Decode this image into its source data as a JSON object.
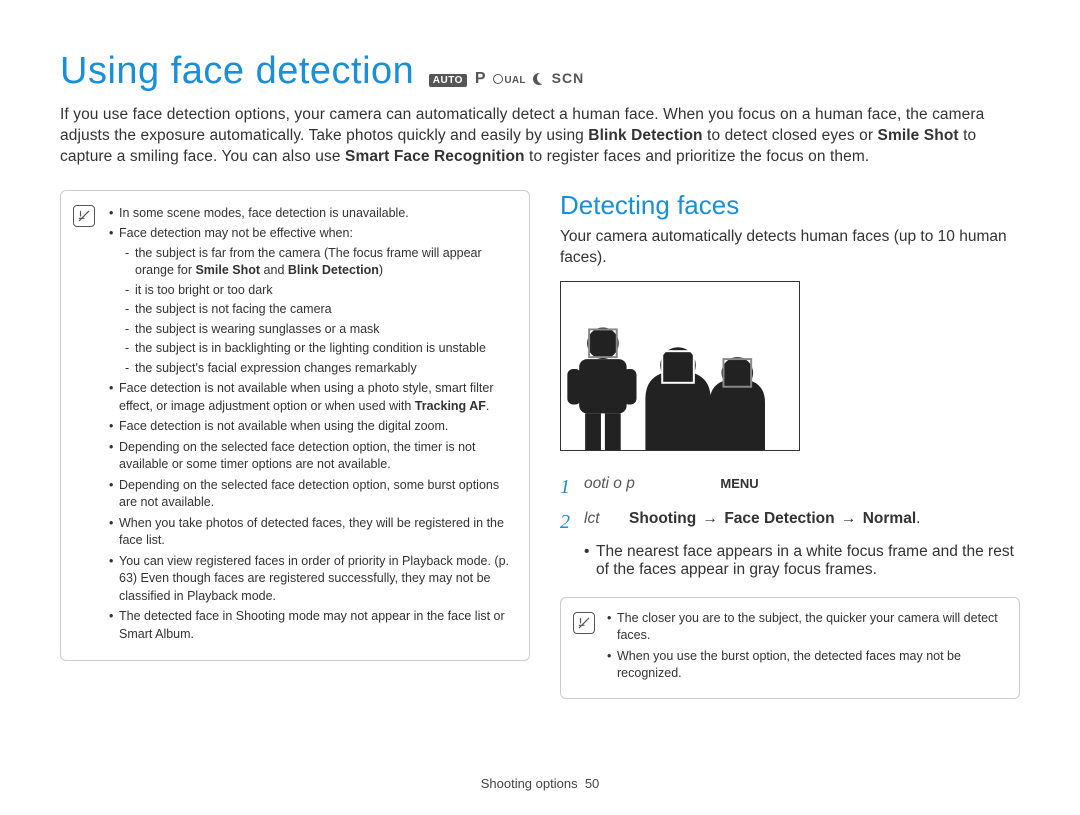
{
  "page_title": "Using face detection",
  "mode_icons": {
    "auto": "AUTO",
    "p": "P",
    "dual": "UAL",
    "scn": "SCN"
  },
  "intro_parts": {
    "a": "If you use face detection options, your camera can automatically detect a human face. When you focus on a human face, the camera adjusts the exposure automatically. Take photos quickly and easily by using ",
    "b1": "Blink Detection",
    "c": " to detect closed eyes or ",
    "b2": "Smile Shot",
    "d": " to capture a smiling face. You can also use ",
    "b3": "Smart Face Recognition",
    "e": " to register faces and prioritize the focus on them."
  },
  "left_notes": {
    "n1": "In some scene modes, face detection is unavailable.",
    "n2": "Face detection may not be effective when:",
    "n2_sub": {
      "s1a": "the subject is far from the camera (The focus frame will appear orange for ",
      "s1b1": "Smile Shot",
      "s1mid": " and ",
      "s1b2": "Blink Detection",
      "s1c": ")",
      "s2": "it is too bright or too dark",
      "s3": "the subject is not facing the camera",
      "s4": "the subject is wearing sunglasses or a mask",
      "s5": "the subject is in backlighting or the lighting condition is unstable",
      "s6": "the subject's facial expression changes remarkably"
    },
    "n3a": "Face detection is not available when using a photo style, smart filter effect, or image adjustment option or when used with ",
    "n3b": "Tracking AF",
    "n3c": ".",
    "n4": "Face detection is not available when using the digital zoom.",
    "n5": "Depending on the selected face detection option, the timer is not available or some timer options are not available.",
    "n6": "Depending on the selected face detection option, some burst options are not available.",
    "n7": "When you take photos of detected faces, they will be registered in the face list.",
    "n8": "You can view registered faces in order of priority in Playback mode. (p. 63) Even though faces are registered successfully, they may not be classified in Playback mode.",
    "n9": "The detected face in Shooting mode may not appear in the face list or Smart Album."
  },
  "section_heading": "Detecting faces",
  "section_desc": "Your camera automatically detects human faces (up to 10 human faces).",
  "steps": {
    "s1_num": "1",
    "s1_ital": "In Shooting mode, press [",
    "s1_ital_display": "ooti o p",
    "s1_menu": "MENU",
    "s1_close": "].",
    "s2_num": "2",
    "s2_ital": "Select",
    "s2_ital_display": "lct",
    "s2_path_a": "Shooting",
    "s2_path_b": "Face Detection",
    "s2_path_c": "Normal",
    "s2_bullet": "The nearest face appears in a white focus frame and the rest of the faces appear in gray focus frames."
  },
  "right_notes": {
    "r1": "The closer you are to the subject, the quicker your camera will detect faces.",
    "r2": "When you use the burst option, the detected faces may not be recognized."
  },
  "footer": {
    "section": "Shooting options",
    "page": "50"
  }
}
